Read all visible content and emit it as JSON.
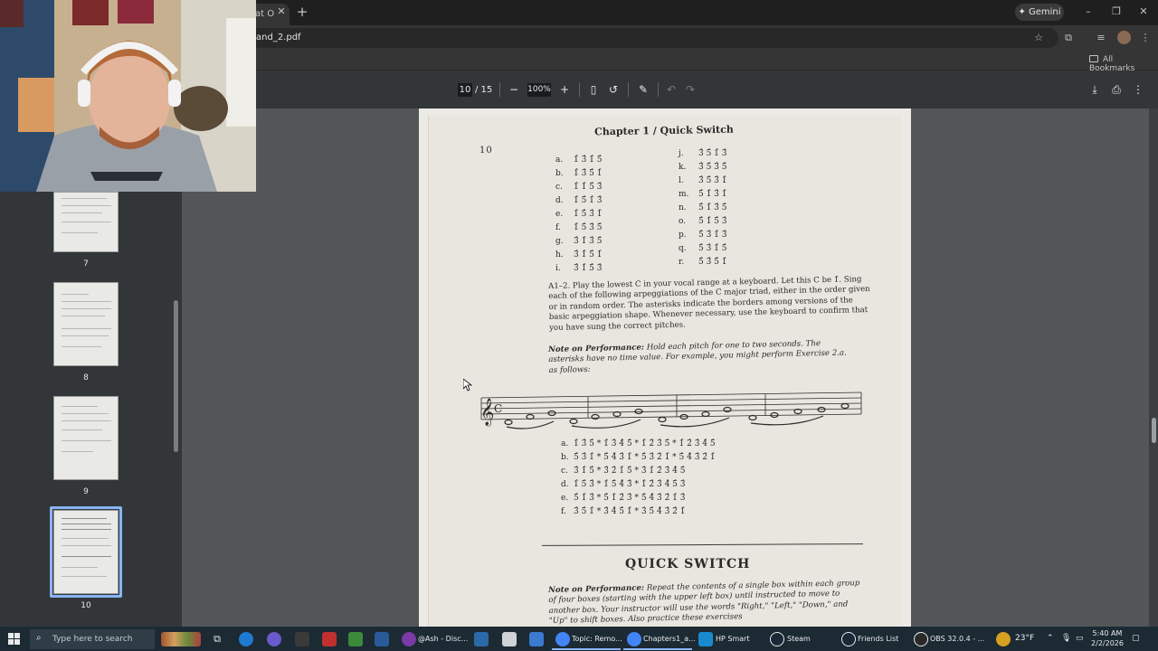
{
  "browser": {
    "tab_title": "at O",
    "url": "and_2.pdf",
    "gemini_label": "Gemini",
    "bookmarks_label": "All Bookmarks"
  },
  "pdf_toolbar": {
    "page_current": "10",
    "page_total": "/ 15",
    "zoom": "100%"
  },
  "thumbnails": [
    {
      "number": "7"
    },
    {
      "number": "8"
    },
    {
      "number": "9"
    },
    {
      "number": "10"
    }
  ],
  "document": {
    "chapter_heading": "Chapter 1 / Quick Switch",
    "page_number": "10",
    "list1_left": [
      {
        "label": "a.",
        "degrees": "1̂  3̂  1̂  5̂"
      },
      {
        "label": "b.",
        "degrees": "1̂  3̂  5̂  1̂"
      },
      {
        "label": "c.",
        "degrees": "1̂  1̂  5̂  3̂"
      },
      {
        "label": "d.",
        "degrees": "1̂  5̂  1̂  3̂"
      },
      {
        "label": "e.",
        "degrees": "1̂  5̂  3̂  1̂"
      },
      {
        "label": "f.",
        "degrees": "1̂  5̂  3̂  5̂"
      },
      {
        "label": "g.",
        "degrees": "3̂  1̂  3̂  5̂"
      },
      {
        "label": "h.",
        "degrees": "3̂  1̂  5̂  1̂"
      },
      {
        "label": "i.",
        "degrees": "3̂  1̂  5̂  3̂"
      }
    ],
    "list1_right": [
      {
        "label": "j.",
        "degrees": "3̂  5̂  1̂  3̂"
      },
      {
        "label": "k.",
        "degrees": "3̂  5̂  3̂  5̂"
      },
      {
        "label": "l.",
        "degrees": "3̂  5̂  3̂  1̂"
      },
      {
        "label": "m.",
        "degrees": "5̂  1̂  3̂  1̂"
      },
      {
        "label": "n.",
        "degrees": "5̂  1̂  3̂  5̂"
      },
      {
        "label": "o.",
        "degrees": "5̂  1̂  5̂  3̂"
      },
      {
        "label": "p.",
        "degrees": "5̂  3̂  1̂  3̂"
      },
      {
        "label": "q.",
        "degrees": "5̂  3̂  1̂  5̂"
      },
      {
        "label": "r.",
        "degrees": "5̂  3̂  5̂  1̂"
      }
    ],
    "exercise_a12": "A1–2.      Play the lowest C in your vocal range at a keyboard. Let this C be 1̂. Sing each of the following arpeggiations of the C major triad, either in the order given or in random order. The asterisks indicate the borders among versions of the basic arpeggiation shape. Whenever necessary, use the keyboard to confirm that you have sung the correct pitches.",
    "note1_title": "Note on Performance:",
    "note1_text": "Hold each pitch for one to two seconds. The asterisks have no time value. For example, you might perform Exercise 2.a. as follows:",
    "list2": [
      {
        "label": "a.",
        "degrees": "1̂  3̂  5̂  *  1̂  3̂  4̂  5̂  *  1̂  2̂  3̂  5̂  *  1̂  2̂  3̂  4̂  5̂"
      },
      {
        "label": "b.",
        "degrees": "5̂  3̂  1̂  *  5̂  4̂  3̂  1̂  *  5̂  3̂  2̂  1̂  *  5̂  4̂  3̂  2̂  1̂"
      },
      {
        "label": "c.",
        "degrees": "3̂  1̂  5̂  *  3̂  2̂  1̂  5̂  *  3̂  1̂  2̂  3̂  4̂  5̂"
      },
      {
        "label": "d.",
        "degrees": "1̂  5̂  3̂  *  1̂  5̂  4̂  3̂  *  1̂  2̂  3̂  4̂  5̂  3̂"
      },
      {
        "label": "e.",
        "degrees": "5̂  1̂  3̂  *  5̂  1̂  2̂  3̂  *  5̂  4̂  3̂  2̂  1̂  3̂"
      },
      {
        "label": "f.",
        "degrees": "3̂  5̂  1̂  *  3̂  4̂  5̂  1̂  *  3̂  5̂  4̂  3̂  2̂  1̂"
      }
    ],
    "section_title": "QUICK SWITCH",
    "note2_title": "Note on Performance:",
    "note2_text": "Repeat the contents of a single box within each group of four boxes (starting with the upper left box) until instructed to move to another box. Your instructor will use the words \"Right,\" \"Left,\" \"Down,\" and \"Up\" to shift boxes. Also practice these exercises"
  },
  "taskbar": {
    "search_placeholder": "Type here to search",
    "items": [
      {
        "label": "@Ash - Disc..."
      },
      {
        "label": "Topic: Remo..."
      },
      {
        "label": "Chapters1_a..."
      },
      {
        "label": "HP Smart"
      },
      {
        "label": "Steam"
      },
      {
        "label": "Friends List"
      },
      {
        "label": "OBS 32.0.4 - ..."
      }
    ],
    "weather": "23°F",
    "time": "5:40 AM",
    "date": "2/2/2026"
  }
}
